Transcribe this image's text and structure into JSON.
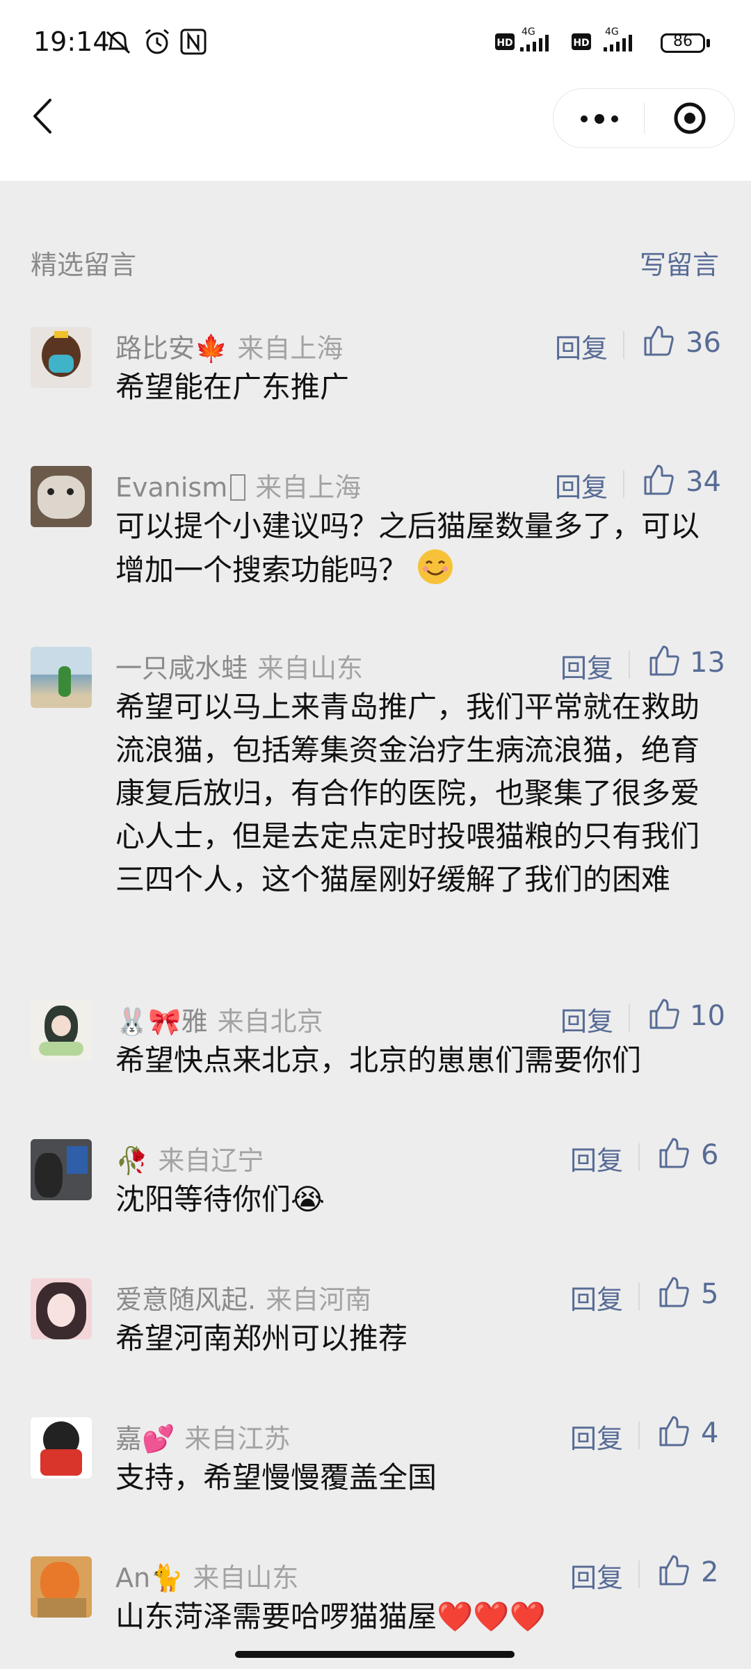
{
  "status_bar": {
    "time": "19:14",
    "battery": "86",
    "network": [
      "4G",
      "4G"
    ],
    "hd": [
      "HD",
      "HD"
    ]
  },
  "nav": {
    "back_icon": "chevron-left-icon",
    "more_icon": "more-dots-icon",
    "close_icon": "target-icon"
  },
  "section": {
    "title": "精选留言",
    "write": "写留言"
  },
  "reply_label": "回复",
  "comments": [
    {
      "name": "路比安🍁",
      "location": "来自上海",
      "likes": "36",
      "text": "希望能在广东推广"
    },
    {
      "name": "Evanism",
      "location": "来自上海",
      "likes": "34",
      "text": "可以提个小建议吗？之后猫屋数量多了，可以增加一个搜索功能吗？"
    },
    {
      "name": "一只咸水蛙",
      "location": "来自山东",
      "likes": "13",
      "text": "希望可以马上来青岛推广，我们平常就在救助流浪猫，包括筹集资金治疗生病流浪猫，绝育康复后放归，有合作的医院，也聚集了很多爱心人士，但是去定点定时投喂猫粮的只有我们三四个人，这个猫屋刚好缓解了我们的困难"
    },
    {
      "name": "🐰🎀雅",
      "location": "来自北京",
      "likes": "10",
      "text": "希望快点来北京，北京的崽崽们需要你们"
    },
    {
      "name": "🥀",
      "location": "来自辽宁",
      "likes": "6",
      "text": "沈阳等待你们😭"
    },
    {
      "name": "爱意随风起.",
      "location": "来自河南",
      "likes": "5",
      "text": "希望河南郑州可以推荐"
    },
    {
      "name": "嘉💕",
      "location": "来自江苏",
      "likes": "4",
      "text": "支持，希望慢慢覆盖全国"
    },
    {
      "name": "An🐈",
      "location": "来自山东",
      "likes": "2",
      "text": "山东菏泽需要哈啰猫猫屋❤️❤️❤️"
    }
  ]
}
